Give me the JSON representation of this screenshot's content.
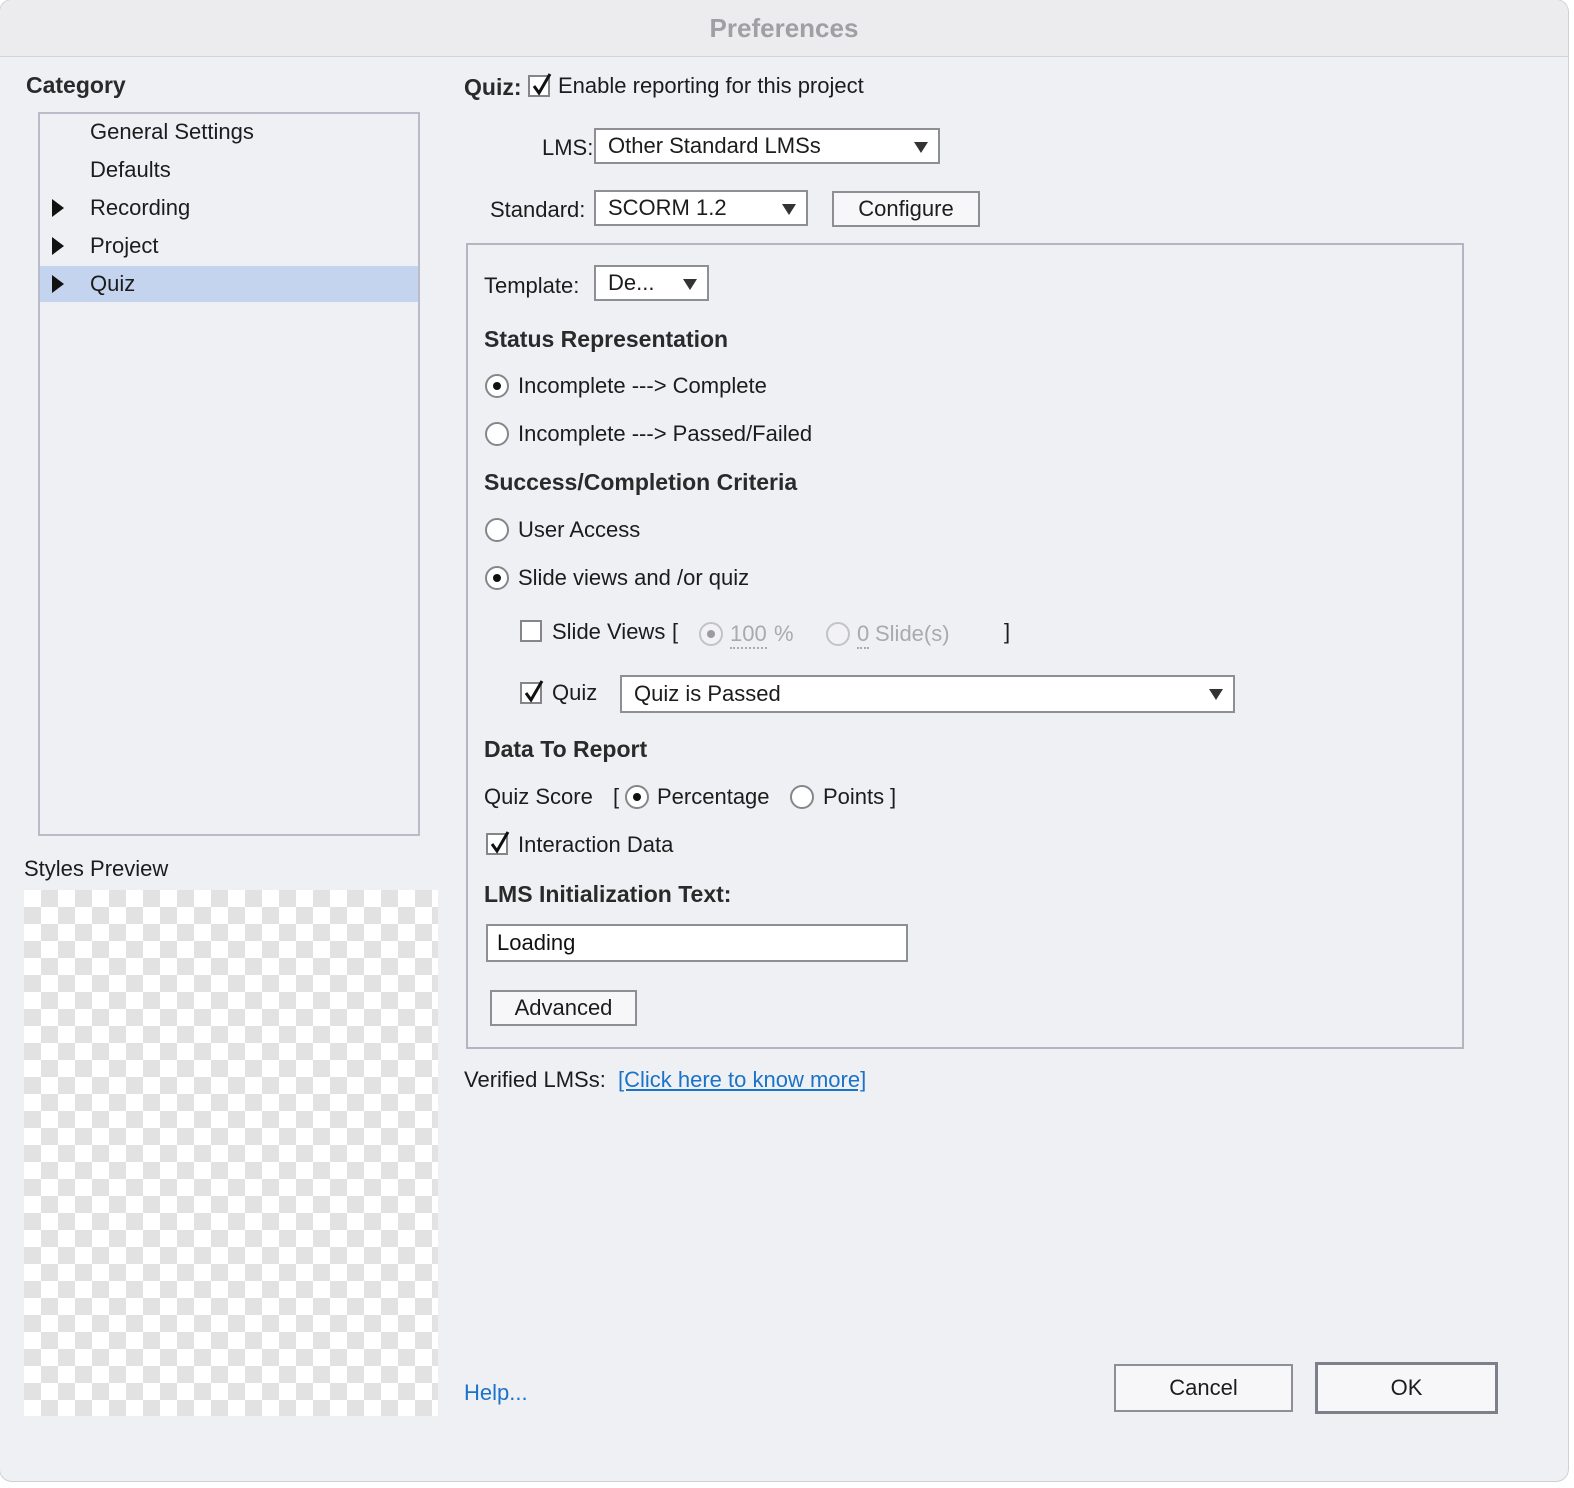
{
  "window": {
    "title": "Preferences"
  },
  "sidebar": {
    "heading": "Category",
    "items": [
      {
        "label": "General Settings",
        "has_arrow": false,
        "selected": false
      },
      {
        "label": "Defaults",
        "has_arrow": false,
        "selected": false
      },
      {
        "label": "Recording",
        "has_arrow": true,
        "selected": false
      },
      {
        "label": "Project",
        "has_arrow": true,
        "selected": false
      },
      {
        "label": "Quiz",
        "has_arrow": true,
        "selected": true
      }
    ],
    "styles_preview_label": "Styles Preview"
  },
  "quiz": {
    "heading": "Quiz:",
    "enable_reporting_label": "Enable reporting for this project",
    "enable_reporting_checked": true,
    "lms_label": "LMS:",
    "lms_value": "Other Standard LMSs",
    "standard_label": "Standard:",
    "standard_value": "SCORM 1.2",
    "configure_label": "Configure",
    "template_label": "Template:",
    "template_value": "De...",
    "status_heading": "Status Representation",
    "status_options": [
      "Incomplete ---> Complete",
      "Incomplete ---> Passed/Failed"
    ],
    "status_selected": 0,
    "criteria_heading": "Success/Completion Criteria",
    "criteria_options": [
      "User Access",
      "Slide views and /or quiz"
    ],
    "criteria_selected": 1,
    "slide_views_label": "Slide Views",
    "slide_views_checked": false,
    "slide_views_bracket_open": "[",
    "slide_views_bracket_close": "]",
    "slide_views_percent_value": "100",
    "slide_views_percent_unit": "%",
    "slide_views_count_value": "0",
    "slide_views_count_unit": "Slide(s)",
    "quiz_check_label": "Quiz",
    "quiz_checked": true,
    "quiz_condition_value": "Quiz is Passed",
    "data_heading": "Data To Report",
    "quiz_score_label": "Quiz Score",
    "quiz_score_bracket_open": "[",
    "quiz_score_bracket_close": "]",
    "quiz_score_options": [
      "Percentage",
      "Points"
    ],
    "quiz_score_selected": 0,
    "interaction_data_label": "Interaction Data",
    "interaction_data_checked": true,
    "lms_init_heading": "LMS Initialization Text:",
    "lms_init_value": "Loading",
    "advanced_label": "Advanced",
    "verified_label": "Verified LMSs:",
    "verified_link": "[Click here to know more]"
  },
  "footer": {
    "help_label": "Help...",
    "cancel_label": "Cancel",
    "ok_label": "OK"
  },
  "colors": {
    "selection": "#c5d4ee",
    "link": "#1a73c8",
    "background": "#eff0f4"
  }
}
